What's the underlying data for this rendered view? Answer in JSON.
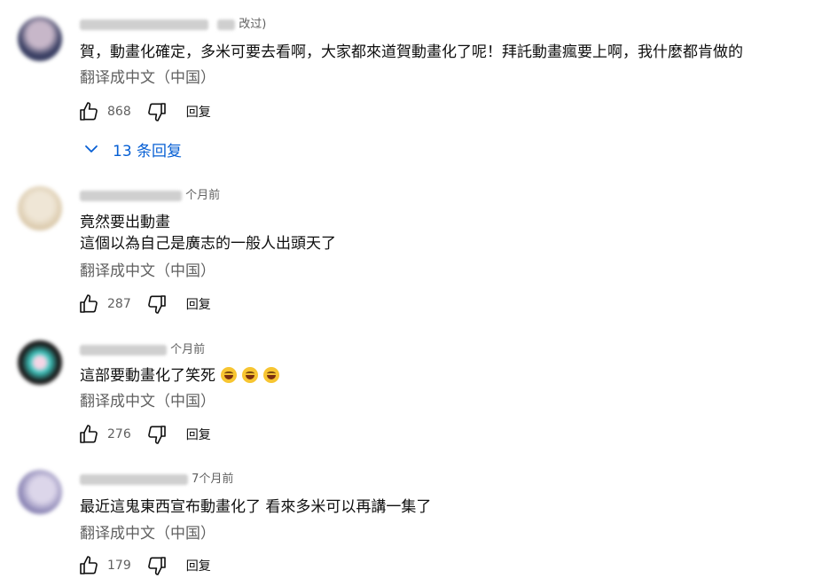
{
  "comments": [
    {
      "meta_suffix": "改过)",
      "text_lines": [
        "賀，動畫化確定，多米可要去看啊，大家都來道賀動畫化了呢！拜託動畫瘋要上啊，我什麼都肯做的"
      ],
      "translate_label": "翻译成中文（中国）",
      "likes": "868",
      "reply_label": "回复",
      "replies_label": "13 条回复",
      "avatar_colors": [
        "#3a3f63",
        "#c7b7c9"
      ]
    },
    {
      "meta_suffix": "个月前",
      "text_lines": [
        "竟然要出動畫",
        "這個以為自己是廣志的一般人出頭天了"
      ],
      "translate_label": "翻译成中文（中国）",
      "likes": "287",
      "reply_label": "回复",
      "avatar_colors": [
        "#d9c7a8",
        "#efe6d6"
      ]
    },
    {
      "meta_suffix": "个月前",
      "text_lines": [
        "這部要動畫化了笑死"
      ],
      "emoji_count": 3,
      "translate_label": "翻译成中文（中国）",
      "likes": "276",
      "reply_label": "回复",
      "avatar_colors": [
        "#1a1a1a",
        "#3cc8c0"
      ]
    },
    {
      "meta_suffix": "7个月前",
      "text_lines": [
        "最近這鬼東西宣布動畫化了 看來多米可以再講一集了"
      ],
      "translate_label": "翻译成中文（中国）",
      "likes": "179",
      "reply_label": "回复",
      "avatar_colors": [
        "#8c86b5",
        "#dcd6ea"
      ]
    }
  ],
  "colors": {
    "text": "#0f0f0f",
    "secondary": "#606060",
    "link_blue": "#065fd4"
  },
  "icons": {
    "like": "thumbs-up-icon",
    "dislike": "thumbs-down-icon",
    "expand": "chevron-down-icon"
  }
}
